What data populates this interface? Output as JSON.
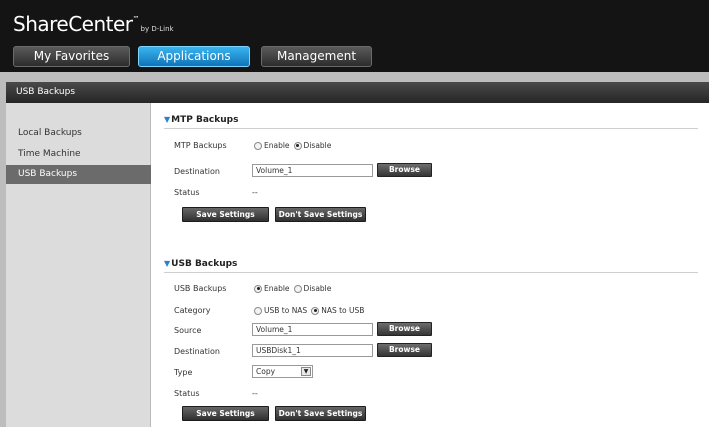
{
  "brand": {
    "name": "ShareCenter",
    "tm": "™",
    "by": "by D-Link"
  },
  "tabs": [
    {
      "label": "My Favorites",
      "active": false
    },
    {
      "label": "Applications",
      "active": true
    },
    {
      "label": "Management",
      "active": false
    }
  ],
  "section_bar": {
    "title": "USB Backups"
  },
  "sidebar": {
    "items": [
      {
        "label": "Local Backups",
        "active": false
      },
      {
        "label": "Time Machine",
        "active": false
      },
      {
        "label": "USB Backups",
        "active": true
      }
    ]
  },
  "mtp": {
    "title": "MTP Backups",
    "backups_label": "MTP Backups",
    "enable_label": "Enable",
    "disable_label": "Disable",
    "selected": "Disable",
    "destination_label": "Destination",
    "destination_value": "Volume_1",
    "browse_label": "Browse",
    "status_label": "Status",
    "status_value": "--",
    "save_label": "Save Settings",
    "dont_save_label": "Don't Save Settings"
  },
  "usb": {
    "title": "USB Backups",
    "backups_label": "USB Backups",
    "enable_label": "Enable",
    "disable_label": "Disable",
    "selected": "Enable",
    "category_label": "Category",
    "cat_usb_to_nas": "USB to NAS",
    "cat_nas_to_usb": "NAS to USB",
    "category_selected": "NAS to USB",
    "source_label": "Source",
    "source_value": "Volume_1",
    "destination_label": "Destination",
    "destination_value": "USBDisk1_1",
    "browse_label": "Browse",
    "type_label": "Type",
    "type_value": "Copy",
    "status_label": "Status",
    "status_value": "--",
    "save_label": "Save Settings",
    "dont_save_label": "Don't Save Settings"
  },
  "colors": {
    "header_bg": "#141414",
    "active_tab": "#1a8fd6",
    "section_bar": "#333333",
    "sidebar_bg": "#dcdcdc",
    "sidebar_active": "#6b6b6b",
    "accent_triangle": "#2a7fd4"
  }
}
